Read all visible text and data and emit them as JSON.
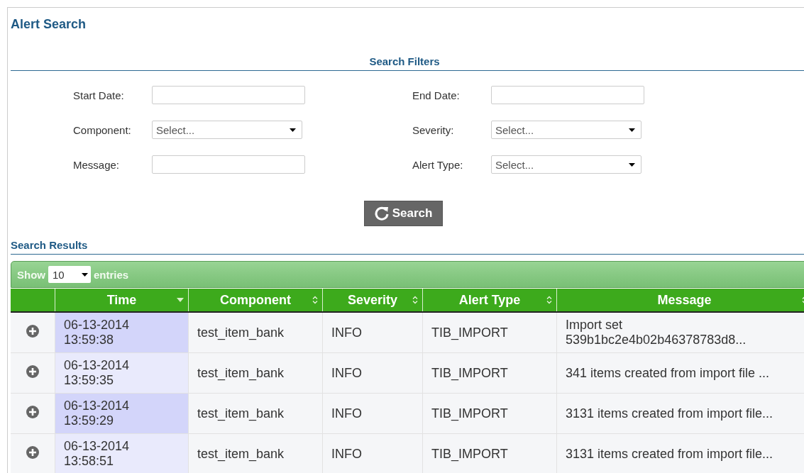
{
  "page": {
    "title": "Alert Search"
  },
  "filters": {
    "heading": "Search Filters",
    "fields": [
      {
        "label": "Start Date:",
        "kind": "text"
      },
      {
        "label": "End Date:",
        "kind": "text"
      },
      {
        "label": "Component:",
        "kind": "select",
        "placeholder": "Select..."
      },
      {
        "label": "Severity:",
        "kind": "select",
        "placeholder": "Select..."
      },
      {
        "label": "Message:",
        "kind": "text"
      },
      {
        "label": "Alert Type:",
        "kind": "select",
        "placeholder": "Select..."
      }
    ],
    "search_button": "Search"
  },
  "results": {
    "heading": "Search Results",
    "length_menu": {
      "prefix": "Show",
      "value": "10",
      "suffix": "entries"
    },
    "table": {
      "columns": [
        {
          "label": "Time",
          "sorted": true
        },
        {
          "label": "Component",
          "sorted": false
        },
        {
          "label": "Severity",
          "sorted": false
        },
        {
          "label": "Alert Type",
          "sorted": false
        },
        {
          "label": "Message",
          "sorted": false
        }
      ],
      "rows": [
        {
          "time": "06-13-2014 13:59:38",
          "component": "test_item_bank",
          "severity": "INFO",
          "alert_type": "TIB_IMPORT",
          "message": "Import set 539b1bc2e4b02b46378783d8..."
        },
        {
          "time": "06-13-2014 13:59:35",
          "component": "test_item_bank",
          "severity": "INFO",
          "alert_type": "TIB_IMPORT",
          "message": "341 items created from import file ..."
        },
        {
          "time": "06-13-2014 13:59:29",
          "component": "test_item_bank",
          "severity": "INFO",
          "alert_type": "TIB_IMPORT",
          "message": "3131 items created from import file..."
        },
        {
          "time": "06-13-2014 13:58:51",
          "component": "test_item_bank",
          "severity": "INFO",
          "alert_type": "TIB_IMPORT",
          "message": "3131 items created from import file..."
        }
      ]
    }
  }
}
